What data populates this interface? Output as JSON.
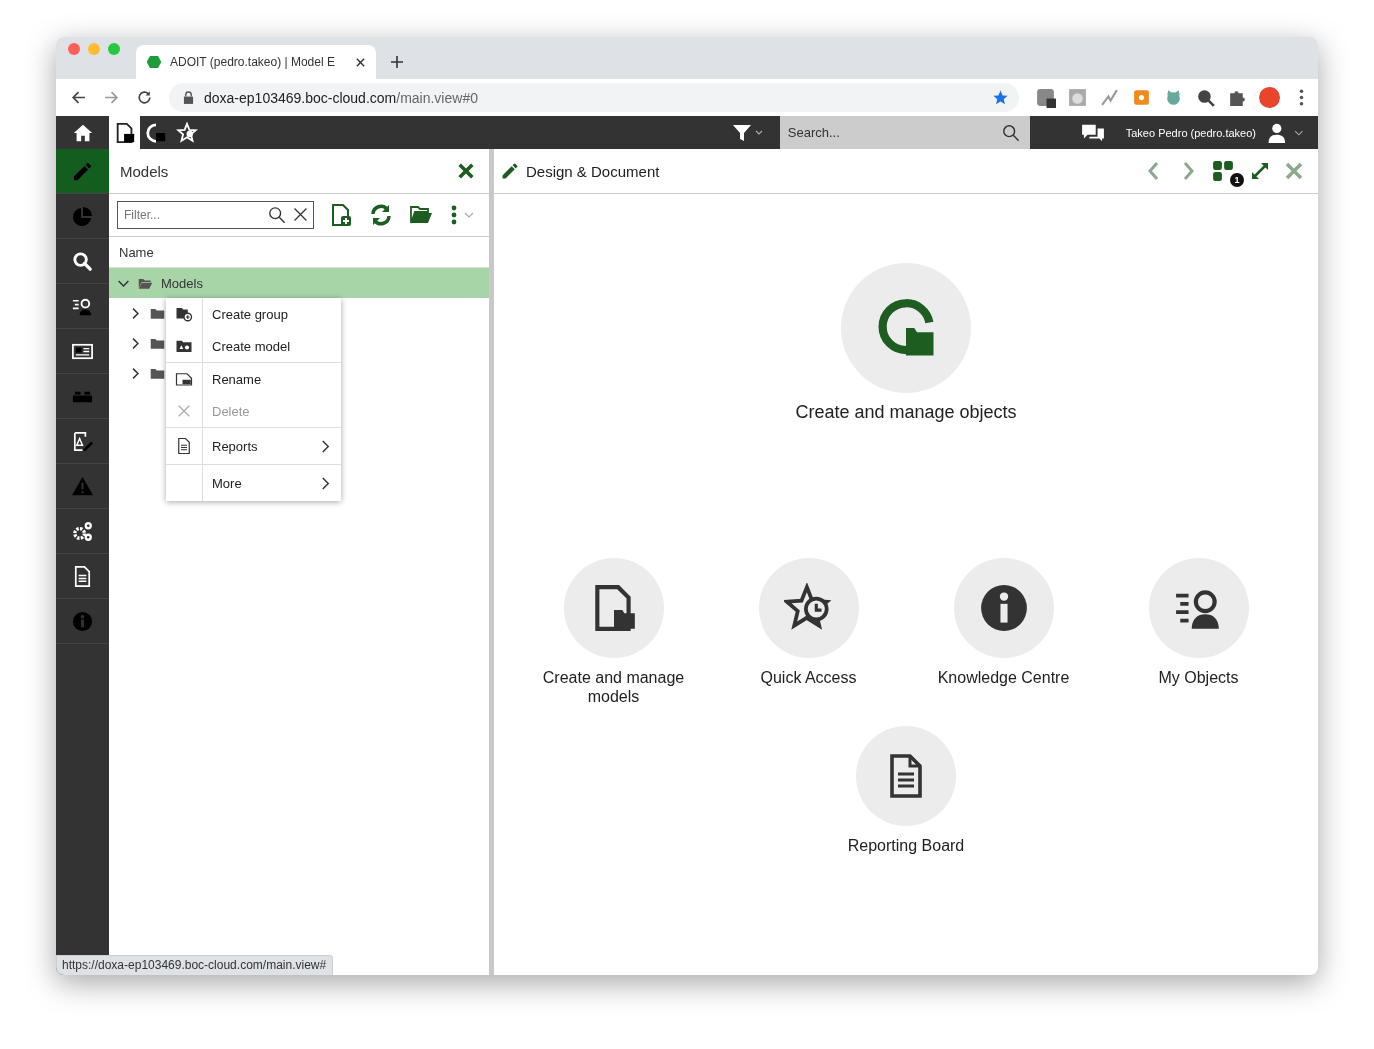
{
  "browser": {
    "tab_title": "ADOIT (pedro.takeo) | Model E",
    "address_host": "doxa-ep103469.boc-cloud.com",
    "address_path": "/main.view#0",
    "status_url": "https://doxa-ep103469.boc-cloud.com/main.view#"
  },
  "topbar": {
    "tabs": [
      {
        "selected": true
      },
      {
        "selected": false
      },
      {
        "selected": false
      }
    ],
    "search": {
      "placeholder": "Search..."
    },
    "user": "Takeo Pedro (pedro.takeo)"
  },
  "sidebar": {
    "items": [
      {
        "selected": true
      },
      {
        "selected": false
      },
      {
        "selected": false
      },
      {
        "selected": false
      },
      {
        "selected": false
      },
      {
        "selected": false
      },
      {
        "selected": false
      },
      {
        "selected": false
      },
      {
        "selected": false
      },
      {
        "selected": false
      },
      {
        "selected": false
      }
    ]
  },
  "models_panel": {
    "title": "Models",
    "filter": {
      "placeholder": "Filter..."
    },
    "column": "Name",
    "tree": [
      {
        "label": "Models",
        "expanded": true,
        "selected": true,
        "children": [
          {
            "expanded": false
          },
          {
            "expanded": false
          },
          {
            "expanded": false
          }
        ]
      }
    ]
  },
  "context_menu": {
    "groups": [
      [
        {
          "label": "Create group",
          "disabled": false,
          "submenu": false
        },
        {
          "label": "Create model",
          "disabled": false,
          "submenu": false
        }
      ],
      [
        {
          "label": "Rename",
          "disabled": false,
          "submenu": false
        },
        {
          "label": "Delete",
          "disabled": true,
          "submenu": false
        }
      ],
      [
        {
          "label": "Reports",
          "disabled": false,
          "submenu": true
        }
      ],
      [
        {
          "label": "More",
          "disabled": false,
          "submenu": true
        }
      ]
    ]
  },
  "design_panel": {
    "title": "Design & Document",
    "badge": "1",
    "hero": {
      "label": "Create and manage objects"
    },
    "tiles": [
      {
        "label": "Create and manage models"
      },
      {
        "label": "Quick Access"
      },
      {
        "label": "Knowledge Centre"
      },
      {
        "label": "My Objects"
      }
    ],
    "bottom_tile": {
      "label": "Reporting Board"
    }
  }
}
